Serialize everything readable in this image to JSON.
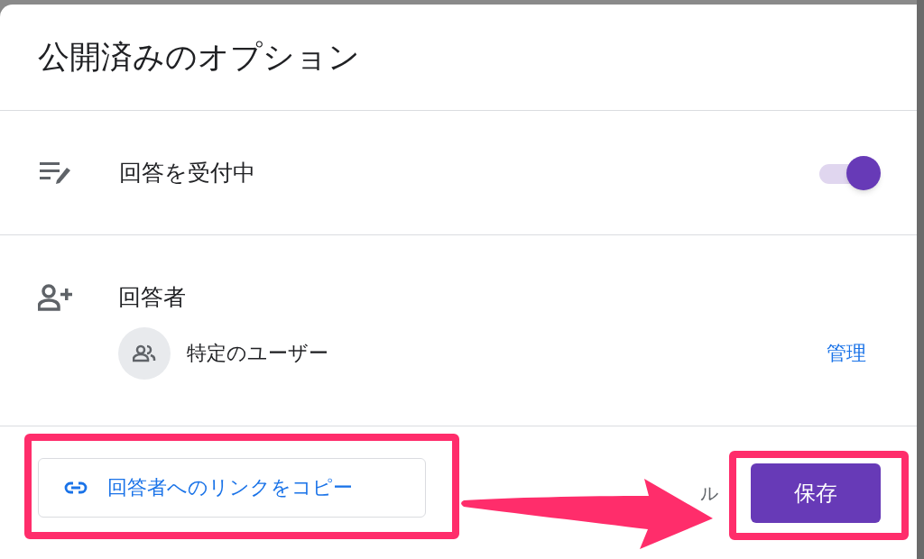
{
  "dialog": {
    "title": "公開済みのオプション",
    "accepting": {
      "label": "回答を受付中",
      "on": true
    },
    "respondents": {
      "label": "回答者",
      "audience": "特定のユーザー",
      "manage_link": "管理"
    },
    "footer": {
      "copy_link_button": "回答者へのリンクをコピー",
      "cancel_button_visible": "ル",
      "save_button": "保存"
    }
  }
}
